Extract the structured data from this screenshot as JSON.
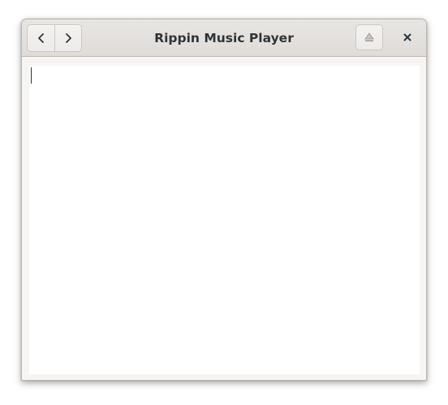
{
  "window": {
    "title": "Rippin Music Player"
  },
  "headerbar": {
    "back_icon": "chevron-left-icon",
    "forward_icon": "chevron-right-icon",
    "eject_icon": "eject-icon",
    "close_icon": "close-icon"
  },
  "content": {
    "text": ""
  },
  "colors": {
    "headerbar_bg": "#dfdcd8",
    "window_bg": "#f6f5f4",
    "content_bg": "#ffffff",
    "title_text": "#2e3436"
  }
}
